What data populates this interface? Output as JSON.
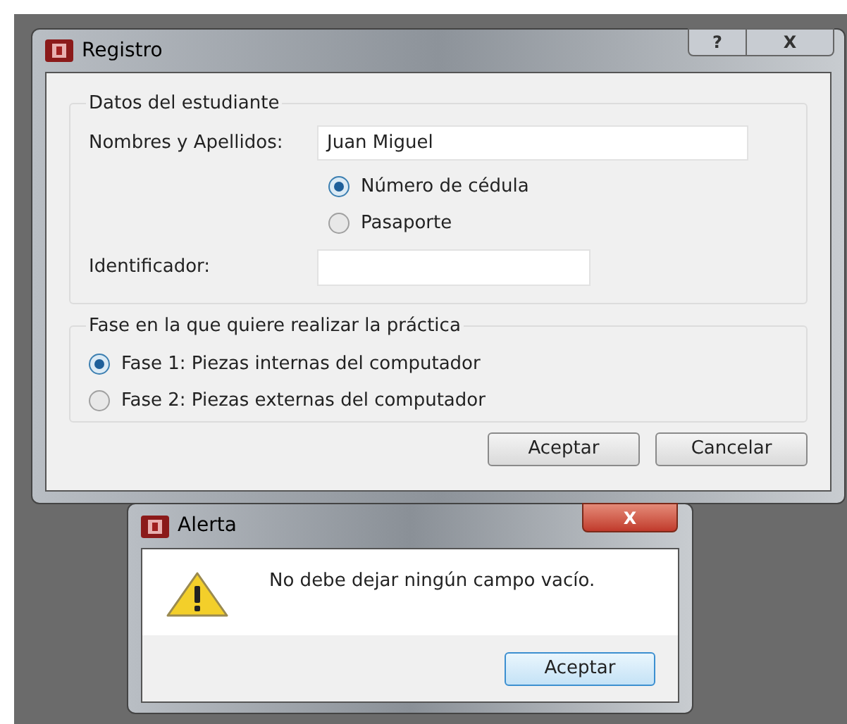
{
  "main_window": {
    "title": "Registro",
    "title_buttons": [
      "?",
      "X"
    ],
    "student_group": {
      "legend": "Datos del estudiante",
      "name_label": "Nombres y Apellidos:",
      "name_value": "Juan Miguel",
      "id_types": [
        {
          "label": "Número de cédula",
          "selected": true
        },
        {
          "label": "Pasaporte",
          "selected": false
        }
      ],
      "id_label": "Identificador:"
    },
    "phase_group": {
      "legend": "Fase en la que quiere realizar la práctica",
      "phases": [
        {
          "label": "Fase 1: Piezas internas del computador",
          "selected": true
        },
        {
          "label": "Fase 2: Piezas externas del computador",
          "selected": false
        }
      ]
    },
    "buttons": [
      "Aceptar",
      "Cancelar"
    ]
  },
  "alert": {
    "title": "Alerta",
    "close": "X",
    "message": "No debe dejar ningún campo vacío.",
    "button": "Aceptar"
  }
}
